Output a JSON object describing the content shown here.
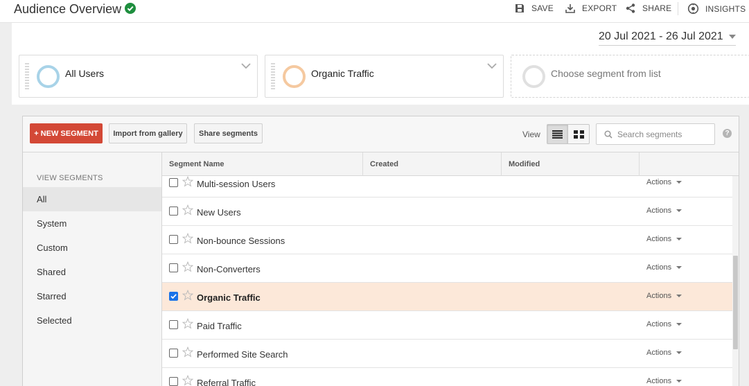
{
  "header": {
    "title": "Audience Overview",
    "tools": {
      "save": "SAVE",
      "export": "EXPORT",
      "share": "SHARE",
      "insights": "INSIGHTS"
    }
  },
  "date_range": "20 Jul 2021 - 26 Jul 2021",
  "segments": [
    {
      "label": "All Users",
      "ring_color": "#a8d3e8"
    },
    {
      "label": "Organic Traffic",
      "ring_color": "#f5c9a0"
    },
    {
      "label": "Choose segment from list",
      "ring_color": "#e0e0e0"
    }
  ],
  "toolbar": {
    "new_segment": "+ NEW SEGMENT",
    "import": "Import from gallery",
    "share": "Share segments",
    "view_label": "View",
    "search_placeholder": "Search segments",
    "help": "?"
  },
  "sidebar": {
    "heading": "VIEW SEGMENTS",
    "items": [
      {
        "label": "All",
        "active": true
      },
      {
        "label": "System"
      },
      {
        "label": "Custom"
      },
      {
        "label": "Shared"
      },
      {
        "label": "Starred"
      },
      {
        "label": "Selected"
      }
    ]
  },
  "table": {
    "columns": [
      "Segment Name",
      "Created",
      "Modified"
    ],
    "rows": [
      {
        "name": "Multi-session Users",
        "checked": false,
        "actions": "Actions"
      },
      {
        "name": "New Users",
        "checked": false,
        "actions": "Actions"
      },
      {
        "name": "Non-bounce Sessions",
        "checked": false,
        "actions": "Actions"
      },
      {
        "name": "Non-Converters",
        "checked": false,
        "actions": "Actions"
      },
      {
        "name": "Organic Traffic",
        "checked": true,
        "actions": "Actions"
      },
      {
        "name": "Paid Traffic",
        "checked": false,
        "actions": "Actions"
      },
      {
        "name": "Performed Site Search",
        "checked": false,
        "actions": "Actions"
      },
      {
        "name": "Referral Traffic",
        "checked": false,
        "actions": "Actions"
      }
    ]
  },
  "colors": {
    "accent_red": "#d34836",
    "selected_row": "#fce8d9",
    "verified": "#1e8e3e"
  }
}
